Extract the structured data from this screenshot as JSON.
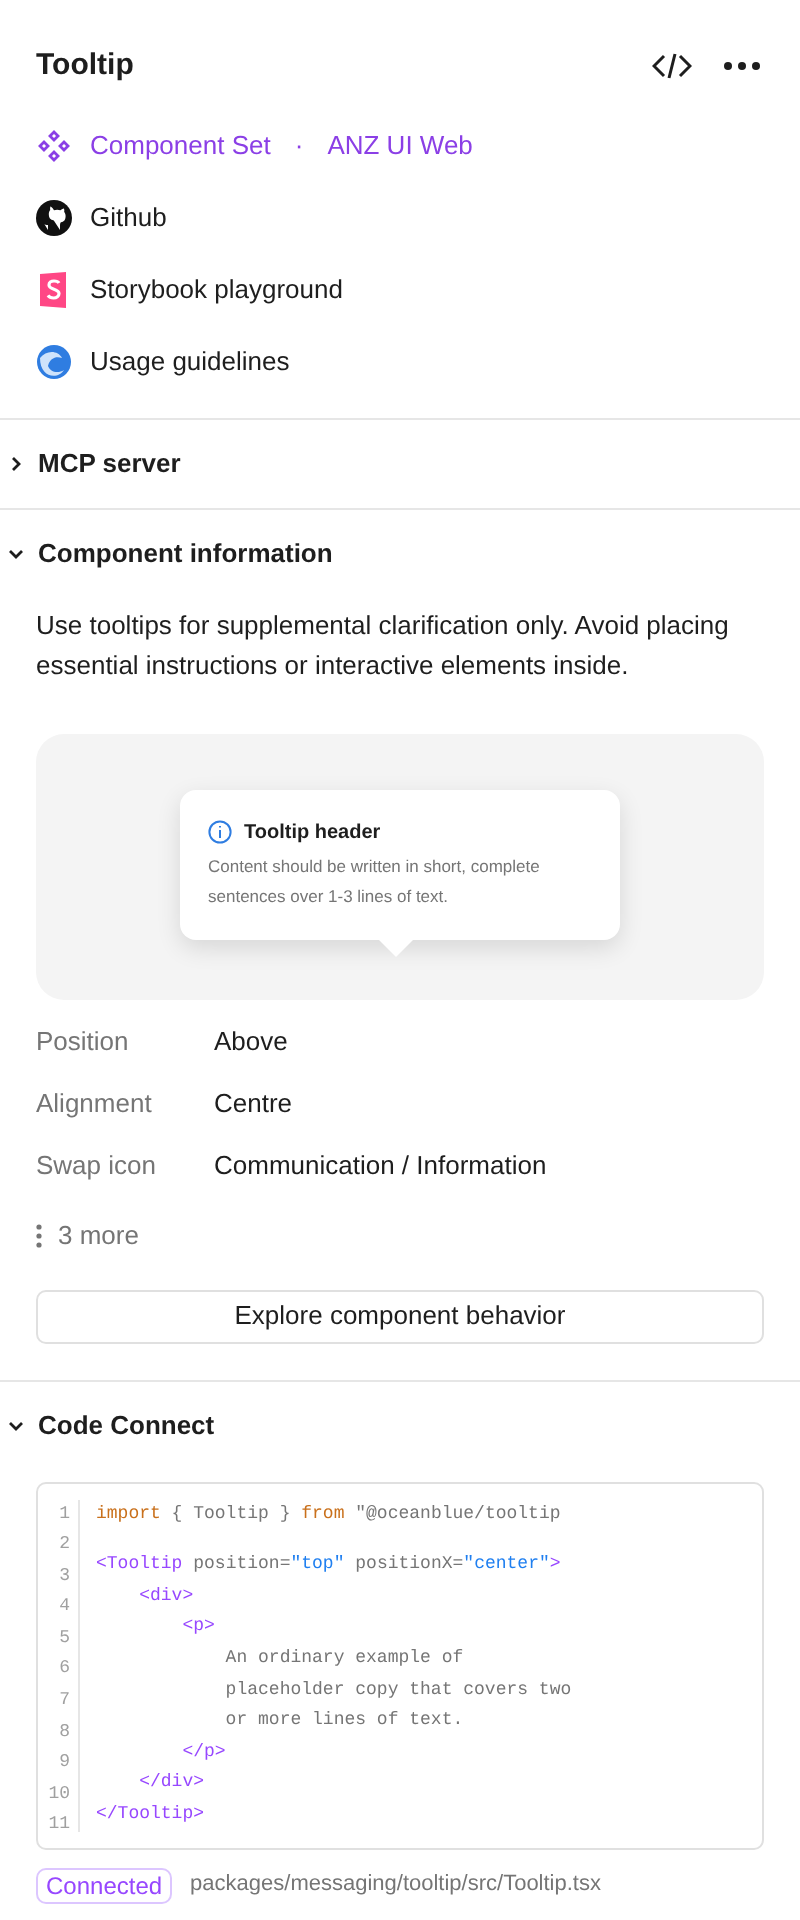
{
  "title": "Tooltip",
  "links": [
    {
      "kind": "component",
      "label": "Component Set",
      "separator": "·",
      "library": "ANZ UI Web"
    },
    {
      "kind": "github",
      "label": "Github"
    },
    {
      "kind": "storybook",
      "label": "Storybook playground"
    },
    {
      "kind": "guidelines",
      "label": "Usage guidelines"
    }
  ],
  "sections": [
    {
      "title": "MCP server",
      "expanded": false
    },
    {
      "title": "Component information",
      "expanded": true
    },
    {
      "title": "Code Connect",
      "expanded": true
    }
  ],
  "description": "Use tooltips for supplemental clarification only. Avoid placing essential instructions or interactive elements inside.",
  "preview": {
    "header": "Tooltip header",
    "body": "Content should be written in short, complete sentences over 1-3 lines of text."
  },
  "properties": [
    {
      "name": "Position",
      "value": "Above"
    },
    {
      "name": "Alignment",
      "value": "Centre"
    },
    {
      "name": "Swap icon",
      "value": "Communication / Information"
    }
  ],
  "more": "3 more",
  "explore_button": "Explore component behavior",
  "code_lines": [
    {
      "number": "1",
      "tokens": [
        {
          "kind": "keyword",
          "t": "import"
        },
        {
          "kind": "text",
          "t": " { Tooltip } "
        },
        {
          "kind": "keyword",
          "t": "from"
        },
        {
          "kind": "text",
          "t": " \"@oceanblue/tooltip"
        }
      ]
    },
    {
      "number": "2"
    },
    {
      "number": "3",
      "tokens": [
        {
          "kind": "tag",
          "t": "<Tooltip"
        },
        {
          "kind": "text",
          "t": " position="
        },
        {
          "kind": "string",
          "t": "\"top\""
        },
        {
          "kind": "text",
          "t": " positionX="
        },
        {
          "kind": "string",
          "t": "\"center\""
        },
        {
          "kind": "tag",
          "t": ">"
        }
      ]
    },
    {
      "number": "4",
      "tokens": [
        {
          "kind": "tag",
          "t": "    <div>"
        }
      ]
    },
    {
      "number": "5",
      "tokens": [
        {
          "kind": "tag",
          "t": "        <p>"
        }
      ]
    },
    {
      "number": "6",
      "tokens": [
        {
          "kind": "text",
          "t": "            An ordinary example of"
        }
      ]
    },
    {
      "number": "7",
      "tokens": [
        {
          "kind": "text",
          "t": "            placeholder copy that covers two"
        }
      ]
    },
    {
      "number": "8",
      "tokens": [
        {
          "kind": "text",
          "t": "            or more lines of text."
        }
      ]
    },
    {
      "number": "9",
      "tokens": [
        {
          "kind": "tag",
          "t": "        </p>"
        }
      ]
    },
    {
      "number": "10",
      "tokens": [
        {
          "kind": "tag",
          "t": "    </div>"
        }
      ]
    },
    {
      "number": "11",
      "tokens": [
        {
          "kind": "tag",
          "t": "</Tooltip>"
        }
      ]
    }
  ],
  "status": {
    "badge": "Connected",
    "path": "packages/messaging/tooltip/src/Tooltip.tsx"
  }
}
